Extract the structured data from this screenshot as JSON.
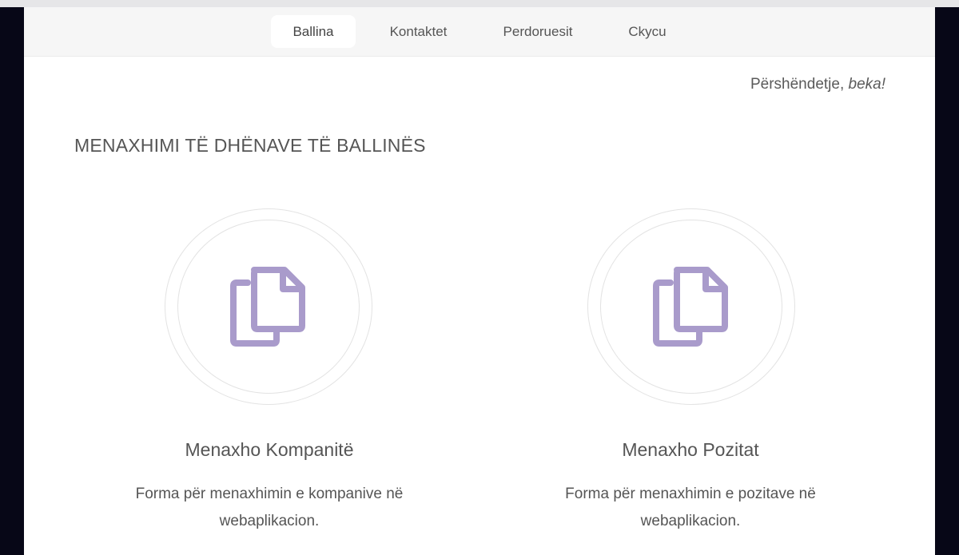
{
  "nav": {
    "items": [
      {
        "label": "Ballina",
        "active": true
      },
      {
        "label": "Kontaktet",
        "active": false
      },
      {
        "label": "Perdoruesit",
        "active": false
      },
      {
        "label": "Ckycu",
        "active": false
      }
    ]
  },
  "greeting": {
    "prefix": "Përshëndetje, ",
    "user": "beka!"
  },
  "section_title": "MENAXHIMI TË DHËNAVE TË BALLINËS",
  "cards": [
    {
      "icon": "copy-documents-icon",
      "title": "Menaxho Kompanitë",
      "desc_line1": "Forma për menaxhimin e kompanive në",
      "desc_line2": "webaplikacion."
    },
    {
      "icon": "copy-documents-icon",
      "title": "Menaxho Pozitat",
      "desc_line1": "Forma për menaxhimin e pozitave në",
      "desc_line2": "webaplikacion."
    }
  ],
  "colors": {
    "icon": "#a99bcb",
    "page_bg": "#070717",
    "navbar_bg": "#f6f6f6"
  }
}
